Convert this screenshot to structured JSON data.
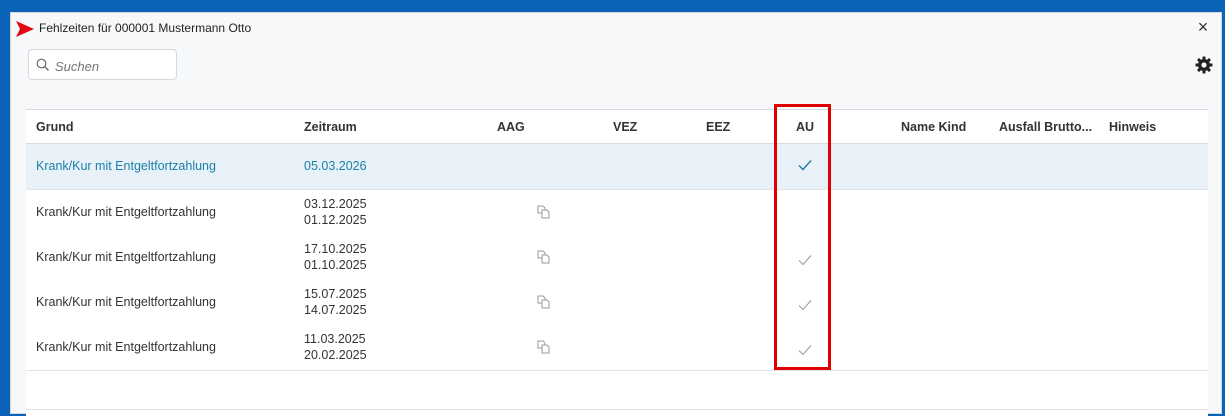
{
  "window": {
    "title": "Fehlzeiten für 000001 Mustermann Otto",
    "close_label": "×"
  },
  "search": {
    "placeholder": "Suchen",
    "value": ""
  },
  "columns": {
    "grund": "Grund",
    "zeitraum": "Zeitraum",
    "aag": "AAG",
    "vez": "VEZ",
    "eez": "EEZ",
    "au": "AU",
    "name_kind": "Name Kind",
    "ausfall_brutto": "Ausfall Brutto...",
    "hinweis": "Hinweis"
  },
  "rows": [
    {
      "grund": "Krank/Kur mit Entgeltfortzahlung",
      "zeitraum_bis": "05.03.2026",
      "zeitraum_von": "",
      "aag": false,
      "au": true,
      "selected": true
    },
    {
      "grund": "Krank/Kur mit Entgeltfortzahlung",
      "zeitraum_bis": "03.12.2025",
      "zeitraum_von": "01.12.2025",
      "aag": true,
      "au": false,
      "selected": false
    },
    {
      "grund": "Krank/Kur mit Entgeltfortzahlung",
      "zeitraum_bis": "17.10.2025",
      "zeitraum_von": "01.10.2025",
      "aag": true,
      "au": true,
      "selected": false
    },
    {
      "grund": "Krank/Kur mit Entgeltfortzahlung",
      "zeitraum_bis": "15.07.2025",
      "zeitraum_von": "14.07.2025",
      "aag": true,
      "au": true,
      "selected": false
    },
    {
      "grund": "Krank/Kur mit Entgeltfortzahlung",
      "zeitraum_bis": "11.03.2025",
      "zeitraum_von": "20.02.2025",
      "aag": true,
      "au": true,
      "selected": false
    }
  ],
  "icons": {
    "logo": "app-logo-icon",
    "search": "search-icon",
    "settings": "gear-icon",
    "aag": "document-copy-icon",
    "au": "checkmark-icon"
  },
  "colors": {
    "accent": "#1a7fa8",
    "selected_row": "#e8f1f8",
    "highlight": "#e00000",
    "logo": "#e30613"
  }
}
